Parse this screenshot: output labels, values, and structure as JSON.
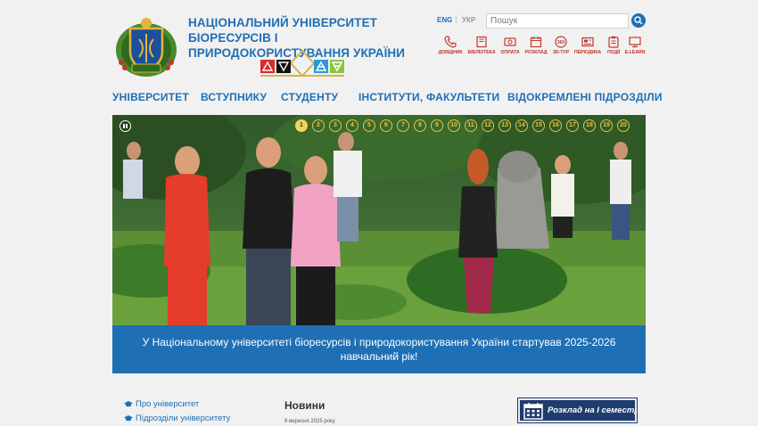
{
  "header": {
    "university_name": "НАЦІОНАЛЬНИЙ УНІВЕРСИТЕТ БІОРЕСУРСІВ І ПРИРОДОКОРИСТУВАННЯ УКРАЇНИ",
    "lang_eng": "ENG",
    "lang_ukr": "УКР",
    "search_placeholder": "Пошук",
    "quick_links": [
      {
        "label": "ДОВІДНИК",
        "icon": "phone-icon"
      },
      {
        "label": "БІБЛІОТЕКА",
        "icon": "book-icon"
      },
      {
        "label": "ОПЛАТА",
        "icon": "payment-icon"
      },
      {
        "label": "РОЗКЛАД",
        "icon": "calendar-icon"
      },
      {
        "label": "3D-ТУР",
        "icon": "tour-360-icon"
      },
      {
        "label": "ПЕРІОДИКА",
        "icon": "newspaper-icon"
      },
      {
        "label": "ПОДІЇ",
        "icon": "events-icon"
      },
      {
        "label": "E-LEARN",
        "icon": "monitor-icon"
      }
    ]
  },
  "nav": {
    "items": [
      "УНІВЕРСИТЕТ",
      "ВСТУПНИКУ",
      "СТУДЕНТУ",
      "ІНСТИТУТИ, ФАКУЛЬТЕТИ",
      "ВІДОКРЕМЛЕНІ ПІДРОЗДІЛИ"
    ]
  },
  "slider": {
    "dots": [
      "1",
      "2",
      "3",
      "4",
      "5",
      "6",
      "7",
      "8",
      "9",
      "10",
      "11",
      "12",
      "13",
      "14",
      "15",
      "16",
      "17",
      "18",
      "19",
      "20"
    ],
    "active_dot": "1",
    "caption": "У Національному університеті біоресурсів і природокористування України стартував 2025-2026 навчальний рік!"
  },
  "sidebar": {
    "links": [
      "Про університет",
      "Підрозділи університету"
    ]
  },
  "news": {
    "title": "Новини",
    "date": "8 вересня 2025 року"
  },
  "schedule_button": {
    "label": "Розклад на І семестр"
  },
  "colors": {
    "primary_blue": "#1f6fb5",
    "accent_red": "#c0392b",
    "dark_navy": "#1e3c6e",
    "slider_gold": "#e8c34a"
  }
}
